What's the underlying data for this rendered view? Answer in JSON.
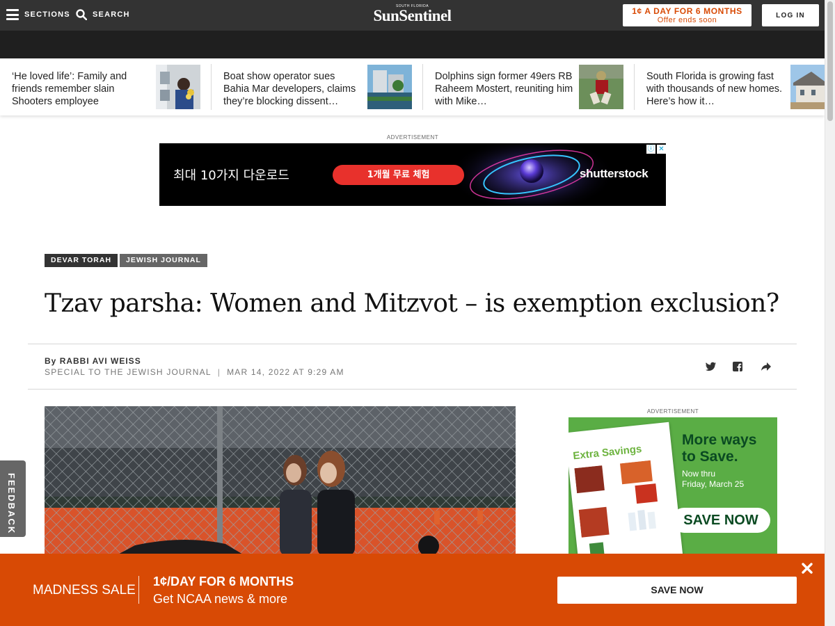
{
  "topbar": {
    "sections_label": "SECTIONS",
    "search_label": "SEARCH",
    "logo_small": "SOUTH FLORIDA",
    "logo_main": "SunSentinel",
    "promo_main": "1¢ A DAY FOR 6 MONTHS",
    "promo_sub": "Offer ends soon",
    "login_label": "LOG IN"
  },
  "strip": [
    {
      "text": "‘He loved life’: Family and friends remember slain Shooters employee",
      "thumb_icon": "memorial-photo"
    },
    {
      "text": "Boat show operator sues Bahia Mar developers, claims they’re blocking dissent…",
      "thumb_icon": "marina-photo"
    },
    {
      "text": "Dolphins sign former 49ers RB Raheem Mostert, reuniting him with Mike…",
      "thumb_icon": "football-player-photo"
    },
    {
      "text": "South Florida is growing fast with thousands of new homes. Here’s how it…",
      "thumb_icon": "house-photo"
    }
  ],
  "ad_top": {
    "label": "ADVERTISEMENT",
    "headline": "최대 10가지 다운로드",
    "button": "1개월 무료 체험",
    "brand": "shutterstock"
  },
  "article": {
    "tags": [
      "DEVAR TORAH",
      "JEWISH JOURNAL"
    ],
    "headline": "Tzav parsha: Women and Mitzvot – is exemption exclusion?",
    "by_prefix": "By",
    "author": "RABBI AVI WEISS",
    "source": "SPECIAL TO THE JEWISH JOURNAL",
    "separator": "|",
    "date": "MAR 14, 2022 AT 9:29 AM"
  },
  "side_ad": {
    "label": "ADVERTISEMENT",
    "flyer_title": "Extra Savings",
    "headline_1": "More ways",
    "headline_2": "to Save.",
    "sub_1": "Now thru",
    "sub_2": "Friday, March 25",
    "button": "SAVE NOW"
  },
  "feedback_label": "FEEDBACK",
  "bottom_promo": {
    "sale_label": "MADNESS SALE",
    "line1": "1¢/DAY FOR 6 MONTHS",
    "line2": "Get NCAA news & more",
    "button": "SAVE NOW"
  },
  "colors": {
    "brand_orange": "#d84a05",
    "topbar": "#333333",
    "ad_green": "#5aad45"
  }
}
